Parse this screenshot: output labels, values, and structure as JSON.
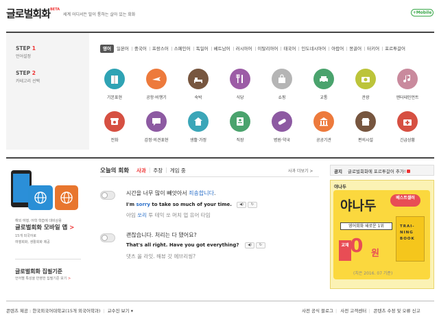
{
  "header": {
    "logo": "글로벌회화",
    "beta": "BETA",
    "slogan": "세계 어디서든 말이 통하는 살아 있는 회화",
    "mobile_button": "+Mobile"
  },
  "steps": [
    {
      "num": "1",
      "label": "STEP",
      "desc": "언어설정"
    },
    {
      "num": "2",
      "label": "STEP",
      "desc": "카테고리 선택"
    }
  ],
  "languages": [
    "영어",
    "일본어",
    "중국어",
    "프랑스어",
    "스페인어",
    "독일어",
    "베트남어",
    "러시아어",
    "이탈리아어",
    "태국어",
    "인도네시아어",
    "아랍어",
    "몽골어",
    "터키어",
    "포르투갈어"
  ],
  "active_language": "영어",
  "categories": [
    {
      "label": "기본표현",
      "color": "#2fa3b4",
      "icon": "book-icon"
    },
    {
      "label": "공항·비행기",
      "color": "#ed7a3c",
      "icon": "airplane-icon"
    },
    {
      "label": "숙박",
      "color": "#77563f",
      "icon": "bed-icon"
    },
    {
      "label": "식당",
      "color": "#9c5ca6",
      "icon": "utensils-icon"
    },
    {
      "label": "쇼핑",
      "color": "#b5b5b5",
      "icon": "shopping-bag-icon"
    },
    {
      "label": "교통",
      "color": "#4aa36d",
      "icon": "car-icon"
    },
    {
      "label": "관광",
      "color": "#bcc43a",
      "icon": "camera-icon"
    },
    {
      "label": "엔터테인먼트",
      "color": "#c98a9d",
      "icon": "music-icon"
    },
    {
      "label": "전화",
      "color": "#d65042",
      "icon": "phone-icon"
    },
    {
      "label": "감정·의견표현",
      "color": "#8d5aa2",
      "icon": "speech-bubble-icon"
    },
    {
      "label": "생활·가정",
      "color": "#3ba6b8",
      "icon": "house-icon"
    },
    {
      "label": "직장",
      "color": "#4aa36d",
      "icon": "id-card-icon"
    },
    {
      "label": "병원·약국",
      "color": "#8d5aa2",
      "icon": "bandage-icon"
    },
    {
      "label": "공공기관",
      "color": "#ed7a3c",
      "icon": "building-icon"
    },
    {
      "label": "편의시설",
      "color": "#77563f",
      "icon": "store-icon"
    },
    {
      "label": "긴급상황",
      "color": "#d65042",
      "icon": "first-aid-icon"
    }
  ],
  "app_promo": {
    "line1": "해외 여행, 어학 학습에 대비상용",
    "title": "글로벌회화 모바일 앱",
    "arrow": ">",
    "line2": "15개 외국어로",
    "line3": "여행회화, 생활회화 제공",
    "standard_title": "글로벌회화 집필기준",
    "standard_desc": "언어별 특성을 반영한 집필기준 보기",
    "standard_arrow": ">"
  },
  "conversation": {
    "title": "오늘의 회화",
    "tabs": [
      "사과",
      "주장",
      "게임 중"
    ],
    "active_tab": "사과",
    "more": "사과 더보기 >",
    "items": [
      {
        "ko_pre": "시간을 너무 많이 빼앗아서 ",
        "ko_hl": "죄송합니다",
        "ko_post": ".",
        "en_pre": "I'm ",
        "en_hl": "sorry",
        "en_post": " to take so much of your time.",
        "pr_pre": "아임 ",
        "pr_hl": "쏘리",
        "pr_post": " 투 테익 쏘 머치 업 유어 타임"
      },
      {
        "ko": "괜찮습니다. 처리는 다 됐어요?",
        "en": "That's all right. Have you got everything?",
        "pr": "댓츠 올 라잇. 해뷰 갓 에브리씽?"
      }
    ],
    "play_icon": "speaker-icon",
    "repeat_icon": "repeat-icon"
  },
  "notice": {
    "label": "공지",
    "text": "글로벌회화에 포르투갈어 추가!"
  },
  "ad": {
    "brand": "야나두",
    "title": "야나두",
    "best": "베스트셀러",
    "subtitle": "영어회화 새로운 1위",
    "badge": "교재",
    "zero": "0",
    "won": "원",
    "book": "TRAI-NING BOOK",
    "note": "(치은 2016. 07 기준)"
  },
  "footer": {
    "left_label": "콘텐츠 제공 :",
    "left_value": "한국외국어대학교(15개 외국어학과)",
    "professor": "교수진 보기",
    "links": [
      "사전 공식 블로그",
      "사전 고객센터",
      "콘텐츠 수정 및 오류 신고"
    ]
  }
}
